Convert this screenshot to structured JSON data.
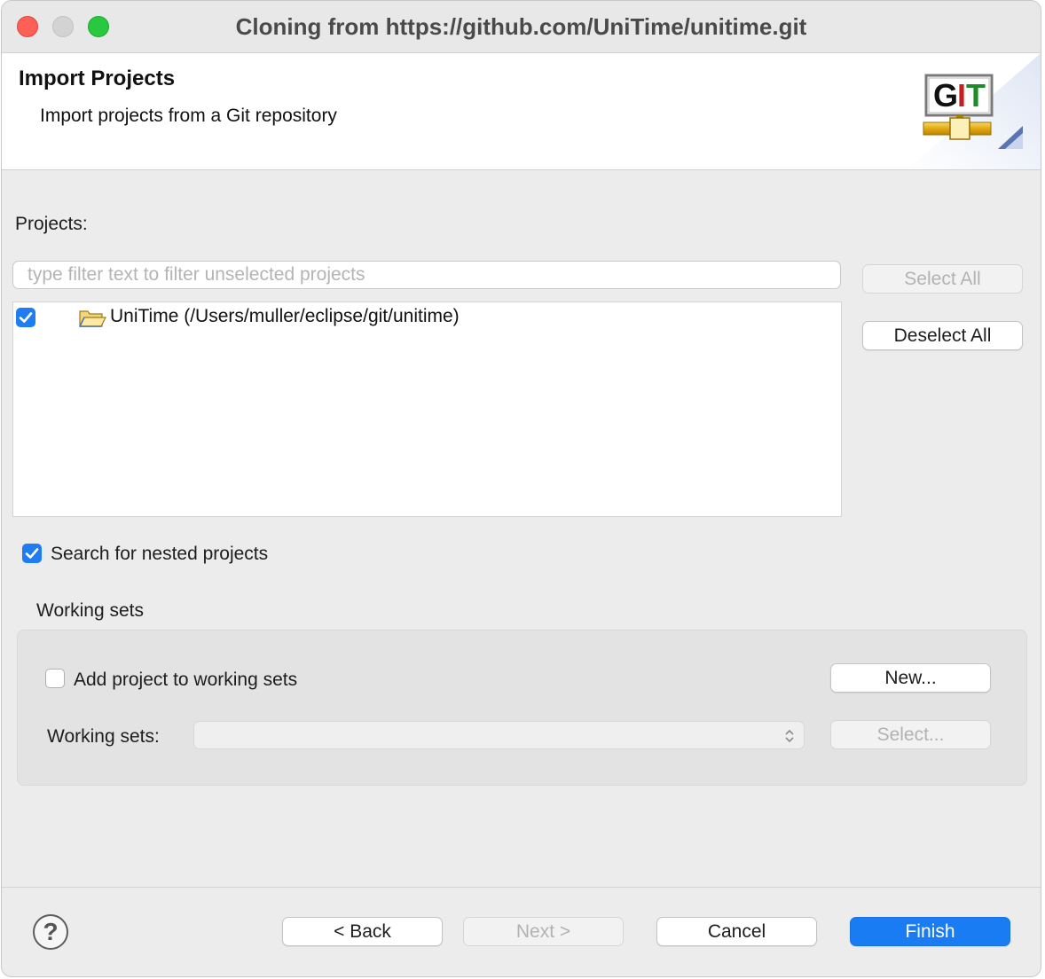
{
  "window": {
    "title": "Cloning from https://github.com/UniTime/unitime.git"
  },
  "header": {
    "title": "Import Projects",
    "description": "Import projects from a Git repository",
    "logo_text": "GIT"
  },
  "projects": {
    "label": "Projects:",
    "filter_placeholder": "type filter text to filter unselected projects",
    "filter_value": "",
    "items": [
      {
        "label": "UniTime (/Users/muller/eclipse/git/unitime)",
        "checked": true,
        "icon": "folder-icon"
      }
    ],
    "select_all_label": "Select All",
    "deselect_all_label": "Deselect All"
  },
  "nested": {
    "label": "Search for nested projects",
    "checked": true
  },
  "working_sets": {
    "section_label": "Working sets",
    "add_label": "Add project to working sets",
    "add_checked": false,
    "new_label": "New...",
    "field_label": "Working sets:",
    "field_value": "",
    "select_label": "Select..."
  },
  "footer": {
    "help_symbol": "?",
    "back_label": "< Back",
    "next_label": "Next >",
    "cancel_label": "Cancel",
    "finish_label": "Finish"
  },
  "colors": {
    "accent": "#1a7cf2",
    "close": "#fe5f57",
    "zoom": "#28c840"
  }
}
